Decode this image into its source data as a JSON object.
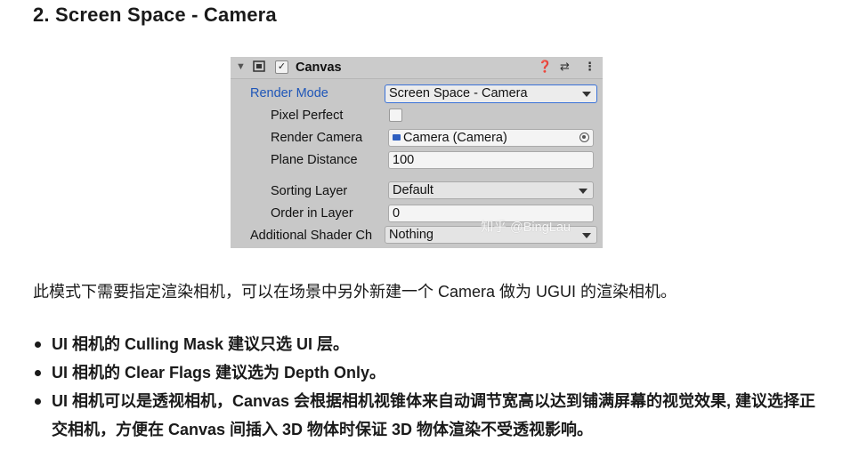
{
  "heading": "2. Screen Space - Camera",
  "inspector": {
    "component_title": "Canvas",
    "enabled": true,
    "header_icons": [
      "help-icon",
      "preset-icon",
      "kebab-menu-icon"
    ],
    "rows": {
      "render_mode": {
        "label": "Render Mode",
        "value": "Screen Space - Camera"
      },
      "pixel_perfect": {
        "label": "Pixel Perfect",
        "checked": false
      },
      "render_camera": {
        "label": "Render Camera",
        "value": "Camera (Camera)"
      },
      "plane_distance": {
        "label": "Plane Distance",
        "value": "100"
      },
      "sorting_layer": {
        "label": "Sorting Layer",
        "value": "Default"
      },
      "order_in_layer": {
        "label": "Order in Layer",
        "value": "0"
      },
      "additional_shader": {
        "label": "Additional Shader Ch",
        "value": "Nothing"
      }
    }
  },
  "watermark": "知乎 @BingLau",
  "paragraph": "此模式下需要指定渲染相机，可以在场景中另外新建一个 Camera 做为 UGUI 的渲染相机。",
  "bullets": [
    "UI 相机的 Culling Mask 建议只选 UI 层。",
    "UI 相机的 Clear Flags 建议选为 Depth Only。",
    "UI 相机可以是透视相机，Canvas 会根据相机视锥体来自动调节宽高以达到铺满屏幕的视觉效果, 建议选择正交相机，方便在 Canvas 间插入 3D 物体时保证 3D 物体渲染不受透视影响。"
  ]
}
